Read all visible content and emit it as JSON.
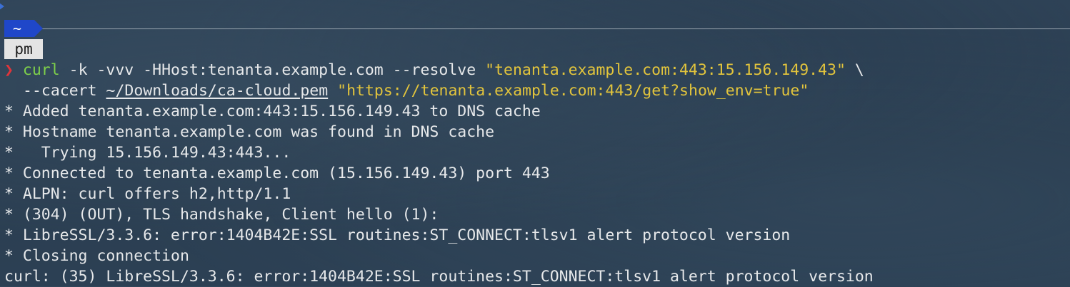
{
  "prompt": {
    "home_symbol": "~",
    "directory": "pm",
    "caret": "❯"
  },
  "command": {
    "program": "curl",
    "args_line1": " -k -vvv -HHost:tenanta.example.com --resolve ",
    "resolve_string": "\"tenanta.example.com:443:15.156.149.43\"",
    "continuation": " \\",
    "cacert_flag": "--cacert ",
    "cacert_path": "~/Downloads/ca-cloud.pem",
    "space": " ",
    "url": "\"https://tenanta.example.com:443/get?show_env=true\""
  },
  "output": [
    "* Added tenanta.example.com:443:15.156.149.43 to DNS cache",
    "* Hostname tenanta.example.com was found in DNS cache",
    "*   Trying 15.156.149.43:443...",
    "* Connected to tenanta.example.com (15.156.149.43) port 443",
    "* ALPN: curl offers h2,http/1.1",
    "* (304) (OUT), TLS handshake, Client hello (1):",
    "* LibreSSL/3.3.6: error:1404B42E:SSL routines:ST_CONNECT:tlsv1 alert protocol version",
    "* Closing connection",
    "curl: (35) LibreSSL/3.3.6: error:1404B42E:SSL routines:ST_CONNECT:tlsv1 alert protocol version"
  ],
  "colors": {
    "command": "#7ed04a",
    "string": "#e2c43c",
    "caret": "#e0343a",
    "prompt_segment": "#1f47c9"
  }
}
